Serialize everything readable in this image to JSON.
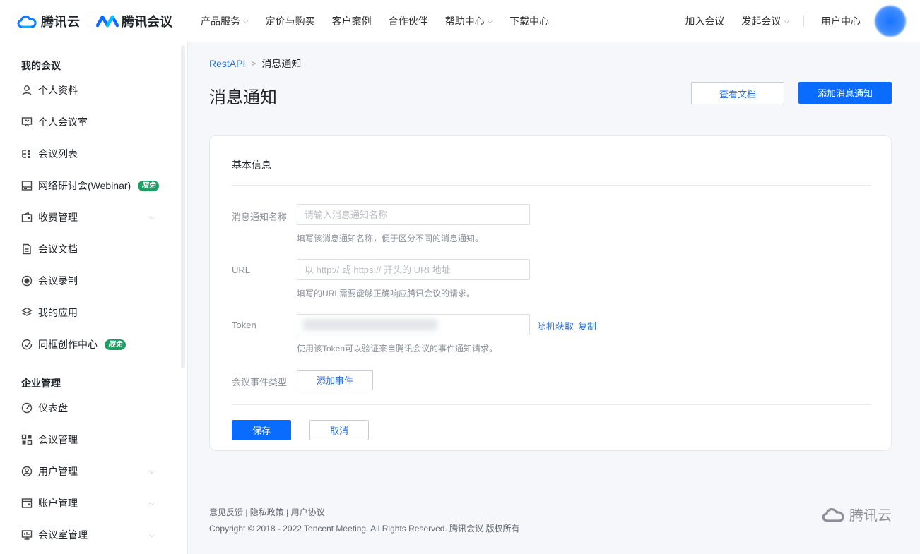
{
  "header": {
    "brand_cloud": "腾讯云",
    "brand_meeting": "腾讯会议",
    "nav": [
      {
        "label": "产品服务",
        "has_dropdown": true
      },
      {
        "label": "定价与购买",
        "has_dropdown": false
      },
      {
        "label": "客户案例",
        "has_dropdown": false
      },
      {
        "label": "合作伙伴",
        "has_dropdown": false
      },
      {
        "label": "帮助中心",
        "has_dropdown": true
      },
      {
        "label": "下载中心",
        "has_dropdown": false
      }
    ],
    "right": {
      "join": "加入会议",
      "start": "发起会议",
      "user_center": "用户中心"
    },
    "chevron": "⌵"
  },
  "sidebar": {
    "section_my": "我的会议",
    "section_enterprise": "企业管理",
    "badge": "限免",
    "items": [
      {
        "label": "个人资料",
        "icon": "user-icon"
      },
      {
        "label": "个人会议室",
        "icon": "room-icon"
      },
      {
        "label": "会议列表",
        "icon": "list-icon"
      },
      {
        "label": "网络研讨会(Webinar)",
        "icon": "webinar-icon"
      },
      {
        "label": "收费管理",
        "icon": "wallet-icon"
      },
      {
        "label": "会议文档",
        "icon": "document-icon"
      },
      {
        "label": "会议录制",
        "icon": "record-icon"
      },
      {
        "label": "我的应用",
        "icon": "layers-icon"
      },
      {
        "label": "同框创作中心",
        "icon": "create-icon"
      },
      {
        "label": "仪表盘",
        "icon": "dashboard-icon"
      },
      {
        "label": "会议管理",
        "icon": "grid-icon"
      },
      {
        "label": "用户管理",
        "icon": "users-icon"
      },
      {
        "label": "账户管理",
        "icon": "account-icon"
      },
      {
        "label": "会议室管理",
        "icon": "meeting-room-icon"
      }
    ]
  },
  "breadcrumb": {
    "parent": "RestAPI",
    "sep": ">",
    "current": "消息通知"
  },
  "page": {
    "title": "消息通知",
    "view_docs": "查看文档",
    "add_notification": "添加消息通知"
  },
  "form": {
    "section_title": "基本信息",
    "name_label": "消息通知名称",
    "name_placeholder": "请输入消息通知名称",
    "name_help": "填写该消息通知名称，便于区分不同的消息通知。",
    "url_label": "URL",
    "url_placeholder": "以 http:// 或 https:// 开头的 URI 地址",
    "url_help": "填写的URL需要能够正确响应腾讯会议的请求。",
    "token_label": "Token",
    "token_random": "随机获取",
    "token_copy": "复制",
    "token_help": "使用该Token可以验证来自腾讯会议的事件通知请求。",
    "event_label": "会议事件类型",
    "add_event": "添加事件",
    "save": "保存",
    "cancel": "取消"
  },
  "footer": {
    "links": "意见反馈 | 隐私政策 | 用户协议",
    "copyright": "Copyright © 2018 - 2022 Tencent Meeting. All Rights Reserved. 腾讯会议 版权所有",
    "brand": "腾讯云"
  },
  "colors": {
    "primary": "#0a6cff",
    "link": "#2a6fdb",
    "badge": "#19a162"
  }
}
